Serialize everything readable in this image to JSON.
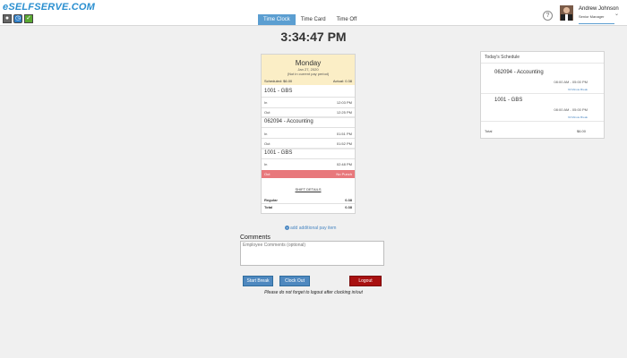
{
  "header": {
    "logo": "eSELFSERVE.COM",
    "tabs": [
      "Time Clock",
      "Time Card",
      "Time Off"
    ],
    "active_tab": "Time Clock",
    "user_name": "Andrew Johnson",
    "user_role": "Senior Manager",
    "help_glyph": "?",
    "accent_color": "#5b9ed1"
  },
  "clock": {
    "time": "3:34:47 PM"
  },
  "timesheet": {
    "day": "Monday",
    "date": "Jan 27, 2020",
    "note": "(Not in current pay period)",
    "scheduled": "Scheduled: $6.00",
    "actual": "Actual: 0.38",
    "entries": [
      {
        "code": "1001 - GBS",
        "in_label": "In",
        "in_time": "12:03 PM",
        "out_label": "Out",
        "out_time": "12:25 PM"
      },
      {
        "code": "062094 - Accounting",
        "in_label": "In",
        "in_time": "01:51 PM",
        "out_label": "Out",
        "out_time": "01:52 PM"
      },
      {
        "code": "1001 - GBS",
        "in_label": "In",
        "in_time": "02:48 PM",
        "out_label": "Out",
        "out_time": "No Punch"
      }
    ],
    "shift_details": "SHIFT DETAILS",
    "regular_label": "Regular",
    "regular_value": "0.38",
    "total_label": "Total",
    "total_value": "0.38"
  },
  "add_pay_item": "add additional pay item",
  "comments": {
    "label": "Comments",
    "placeholder": "Employee Comments (optional)"
  },
  "buttons": {
    "start_break": "Start Break",
    "clock_out": "Clock Out",
    "logout": "Logout"
  },
  "notice": "Please do not forget to logout after clocking in/out",
  "schedule": {
    "title": "Today's Schedule",
    "items": [
      {
        "name": "062094 - Accounting",
        "time": "08:00 AM - 05:00 PM",
        "break": "60 Minute Break"
      },
      {
        "name": "1001 - GBS",
        "time": "08:00 AM - 05:00 PM",
        "break": "60 Minute Break"
      }
    ],
    "total_label": "Total",
    "total_value": "$6.00"
  },
  "colors": {
    "no_punch": "#e8787c",
    "day_header": "#fbeec6",
    "logout": "#a81010",
    "button": "#4e88bf",
    "logo": "#2a8fd0"
  },
  "icons": [
    "person-icon",
    "clock-icon",
    "check-icon",
    "help-icon",
    "chevron-down-icon",
    "plus-icon"
  ]
}
